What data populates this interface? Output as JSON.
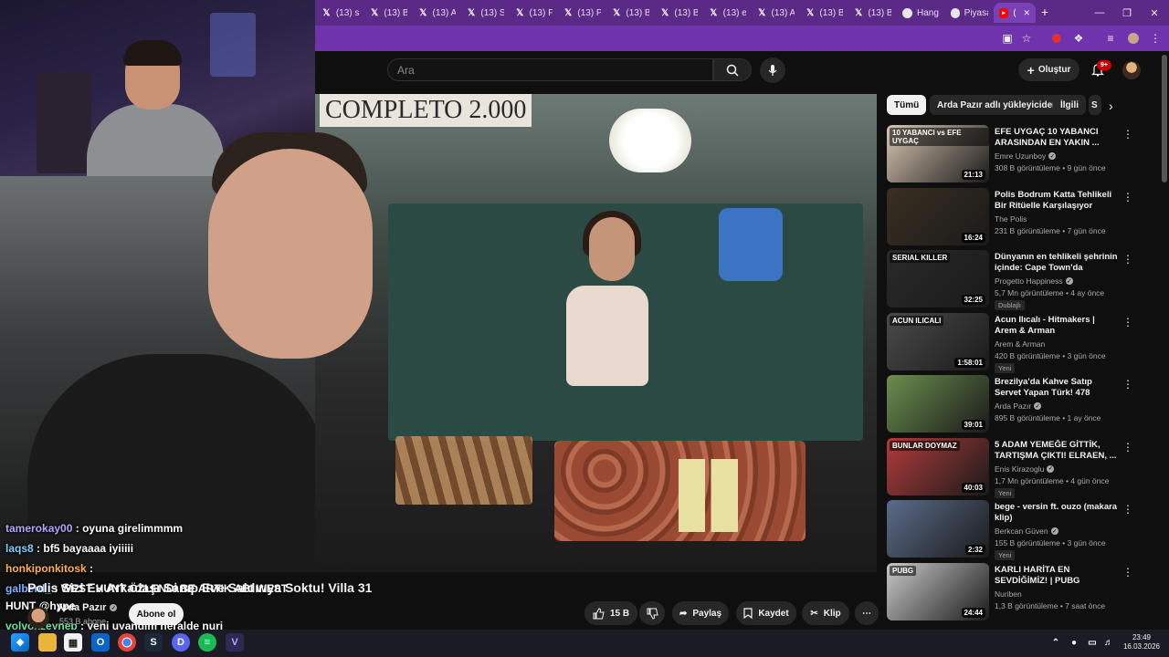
{
  "browser": {
    "tabs": [
      {
        "label": "(13) s",
        "icon": "x-icon"
      },
      {
        "label": "(13) B",
        "icon": "x-icon"
      },
      {
        "label": "(13) A",
        "icon": "x-icon"
      },
      {
        "label": "(13) S",
        "icon": "x-icon"
      },
      {
        "label": "(13) F",
        "icon": "x-icon"
      },
      {
        "label": "(13) P",
        "icon": "x-icon"
      },
      {
        "label": "(13) B",
        "icon": "x-icon"
      },
      {
        "label": "(13) B",
        "icon": "x-icon"
      },
      {
        "label": "(13) e",
        "icon": "x-icon"
      },
      {
        "label": "(13) A",
        "icon": "x-icon"
      },
      {
        "label": "(13) B",
        "icon": "x-icon"
      },
      {
        "label": "(13) B",
        "icon": "x-icon"
      },
      {
        "label": "Hang",
        "icon": "site-icon"
      },
      {
        "label": "Piyasa",
        "icon": "site-icon"
      },
      {
        "label": "(",
        "icon": "youtube-icon"
      }
    ],
    "new_tab": "+",
    "accent": "#5b2a86"
  },
  "youtube": {
    "search_placeholder": "Ara",
    "create_label": "Oluştur",
    "notif_count": "9+",
    "chips": [
      "Tümü",
      "Arda Pazır adlı yükleyiciden",
      "İlgili",
      "S"
    ],
    "video": {
      "sign_text": "COMPLETO 2.000",
      "title": "Polis Sizi Ev Arkadaşı Sanıp Eve Saldırıya Soktu! Villa 31",
      "channel": "Arda Pazır",
      "subs": "553 B abone",
      "subscribe_label": "Abone ol",
      "likes": "15 B",
      "share_label": "Paylaş",
      "save_label": "Kaydet",
      "clip_label": "Klip"
    },
    "recommended": [
      {
        "title": "EFE UYGAÇ 10 YABANCI ARASINDAN EN YAKIN ...",
        "channel": "Emre Uzunboy",
        "verified": true,
        "meta": "308 B görüntüleme • 9 gün önce",
        "duration": "21:13",
        "tag": "",
        "thumb_text": "10 YABANCI vs EFE UYGAÇ",
        "color": "#d9c7b1"
      },
      {
        "title": "Polis Bodrum Katta Tehlikeli Bir Ritüelle Karşılaşıyor",
        "channel": "The Polis",
        "verified": false,
        "meta": "231 B görüntüleme • 7 gün önce",
        "duration": "16:24",
        "tag": "",
        "thumb_text": "",
        "color": "#3a2f22"
      },
      {
        "title": "Dünyanın en tehlikeli şehrinin içinde: Cape Town'da yaşamak...",
        "channel": "Progetto Happiness",
        "verified": true,
        "meta": "5,7 Mn görüntüleme • 4 ay önce",
        "duration": "32:25",
        "tag": "Dublajlı",
        "thumb_text": "SERIAL KILLER",
        "color": "#2a2a2a"
      },
      {
        "title": "Acun Ilıcalı - Hitmakers | Arem & Arman",
        "channel": "Arem & Arman",
        "verified": false,
        "meta": "420 B görüntüleme • 3 gün önce",
        "duration": "1:58:01",
        "tag": "Yeni",
        "thumb_text": "ACUN ILICALI",
        "color": "#4a4a4a"
      },
      {
        "title": "Brezilya'da Kahve Satıp Servet Yapan Türk! 478",
        "channel": "Arda Pazır",
        "verified": true,
        "meta": "895 B görüntüleme • 1 ay önce",
        "duration": "39:01",
        "tag": "",
        "thumb_text": "",
        "color": "#6b8e4e"
      },
      {
        "title": "5 ADAM YEMEĞE GİTTİK, TARTIŞMA ÇIKTI! ELRAEN, ...",
        "channel": "Enis Kirazoglu",
        "verified": true,
        "meta": "1,7 Mn görüntüleme • 4 gün önce",
        "duration": "40:03",
        "tag": "Yeni",
        "thumb_text": "BUNLAR DOYMAZ",
        "color": "#b23a3a"
      },
      {
        "title": "bege - versin ft. ouzo (makara klip)",
        "channel": "Berkcan Güven",
        "verified": true,
        "meta": "155 B görüntüleme • 3 gün önce",
        "duration": "2:32",
        "tag": "Yeni",
        "thumb_text": "",
        "color": "#5a6c8a"
      },
      {
        "title": "KARLI HARİTA EN SEVDİĞİMİZ! | PUBG",
        "channel": "Nuriben",
        "verified": false,
        "meta": "1,3 B görüntüleme • 7 saat önce",
        "duration": "24:44",
        "tag": "",
        "thumb_text": "PUBG",
        "color": "#c9c9c9"
      }
    ]
  },
  "chat": [
    {
      "user": "tamerokay00",
      "msg": ": oyuna girelimmmm",
      "color": "#b7a6ff"
    },
    {
      "user": "laqs8",
      "msg": ": bf5 bayaaaa iyiiiii",
      "color": "#7fd0ff"
    },
    {
      "user": "honkiponkitosk",
      "msg": ":",
      "color": "#ffb347"
    },
    {
      "user": "galberd_",
      "msg": ": WEST HUNT ÖZLENDİ BE ARTIK ABI WEST",
      "color": "#7fb2ff"
    },
    {
      "user": "",
      "msg": "HUNT @hype",
      "color": "#ffffff"
    },
    {
      "user": "volvoxzeynep",
      "msg": ": yeni uyandım heralde nuri",
      "color": "#6ce0a0"
    }
  ],
  "taskbar": {
    "time": "23:49",
    "date": "16.03.2026"
  }
}
